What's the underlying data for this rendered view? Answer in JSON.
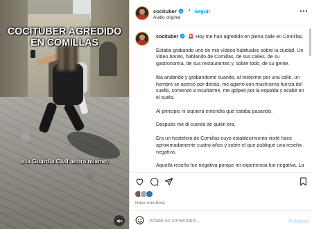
{
  "media": {
    "headline": "COCITUBER AGREDIDO EN COMILLAS",
    "subtitle": "a la Guardia Civil ahora mismo,",
    "mute_icon": "speaker-muted-icon"
  },
  "header": {
    "username": "cocituber",
    "verified": true,
    "separator": "•",
    "follow_label": "Seguir",
    "audio_label": "Audio original",
    "more_icon": "more-options-icon"
  },
  "caption": {
    "username": "cocituber",
    "paragraphs": [
      "🚨 Hoy me han agredido en plena calle en Comillas.",
      "Estaba grabando uno de mis vídeos habituales sobre la ciudad. Un vídeo bonito, hablando de Comillas, de sus calles, de su gastronomía, de sus restaurantes y, sobre todo, de su gente.",
      "Iba andando y grabándome cuando, al meterme por una calle, un hombre se acercó por detrás, me agarró con muchísima fuerza del cuello, comenzó a insultarme, me golpeó por la espalda y acabé en el suelo.",
      "Al principio ni siquiera entendía qué estaba pasando.",
      "Después me di cuenta de quién era.",
      "Era un hostelero de Comillas cuyo establecimiento visité hace aproximadamente cuatro años y sobre el que publiqué una reseña negativa.",
      "Aquella reseña fue negativa porque mi experiencia fue negativa. La paella estaba muy mal, la tarta de manzana también y la"
    ]
  },
  "actions": {
    "like_icon": "heart-icon",
    "comment_icon": "comment-icon",
    "share_icon": "share-icon",
    "save_icon": "bookmark-icon"
  },
  "timestamp": "Hace una hora",
  "comment": {
    "placeholder": "Añade un comentario...",
    "publish_label": "Publicar",
    "emoji_icon": "emoji-icon"
  },
  "colors": {
    "link_blue": "#0095f6",
    "publish_disabled": "#b2dffc",
    "avatar_ring": "#e8a33a"
  }
}
